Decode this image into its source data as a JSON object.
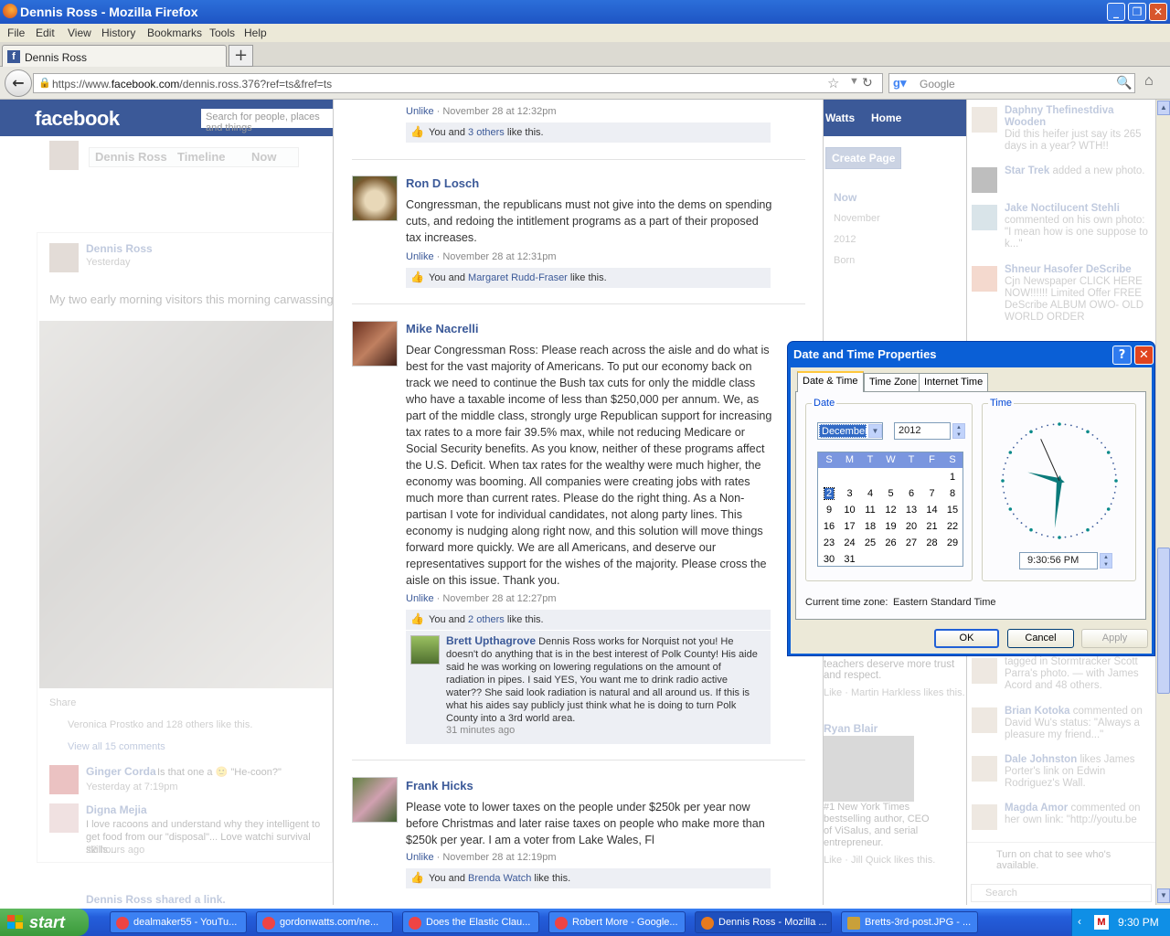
{
  "window": {
    "title": "Dennis Ross - Mozilla Firefox",
    "min": "_",
    "max": "❐",
    "close": "✕"
  },
  "menu": [
    "File",
    "Edit",
    "View",
    "History",
    "Bookmarks",
    "Tools",
    "Help"
  ],
  "tab": {
    "label": "Dennis Ross",
    "new_tab": "+"
  },
  "nav": {
    "url_pre": "https://www.",
    "url_host": "facebook.com",
    "url_post": "/dennis.ross.376?ref=ts&fref=ts",
    "search_placeholder": "Google"
  },
  "fb": {
    "logo": "facebook",
    "search_placeholder": "Search for people, places and things",
    "top_name": "Watts",
    "home": "Home",
    "create_page": "Create Page",
    "profile_name": "Dennis Ross",
    "timeline": "Timeline",
    "now": "Now",
    "timeline_years": [
      "Now",
      "November",
      "2012",
      "Born"
    ],
    "post_author": "Dennis Ross",
    "post_time": "Yesterday",
    "post_text": "My two early morning visitors this morning carwassing",
    "share": "Share",
    "likes_summary": "Veronica Prostko and 128 others like this.",
    "view_all": "View all 15 comments",
    "c1_name": "Ginger Corda",
    "c1_text": "Is that one a 🙂 \"He-coon?\"",
    "c1_time": "Yesterday at 7:19pm",
    "c2_name": "Digna Mejia",
    "c2_text": "I love racoons and understand why they intelligent to get food from our \"disposal\"... Love watchi survival skills...",
    "c2_time": "22 hours ago",
    "shared_link": "Dennis Ross shared a link.",
    "right_col_text": "teachers deserve more trust and respect.",
    "right_col_like": "Like · Martin Harkless likes this.",
    "ryan_name": "Ryan Blair",
    "ryan_text": "#1 New York Times bestselling author, CEO of ViSalus, and serial entrepreneur.",
    "ryan_like": "Like · Jill Quick likes this."
  },
  "comments": [
    {
      "meta_action": "Unlike",
      "meta_time": "November 28 at 12:32pm",
      "like_pre": "You and ",
      "like_link": "3 others",
      "like_post": " like this."
    },
    {
      "name": "Ron D Losch",
      "body": "Congressman, the republicans must not give into the dems on spending cuts, and redoing the intitlement programs as a part of their proposed tax increases.",
      "meta_action": "Unlike",
      "meta_time": "November 28 at 12:31pm",
      "like_pre": "You and ",
      "like_link": "Margaret Rudd-Fraser",
      "like_post": " like this."
    },
    {
      "name": "Mike Nacrelli",
      "body": "Dear Congressman Ross: Please reach across the aisle and do what is best for the vast majority of Americans. To put our economy back on track we need to continue the Bush tax cuts for only the middle class who have a taxable income of less than $250,000 per annum. We, as part of the middle class, strongly urge Republican support for increasing tax rates to a more fair 39.5% max, while not reducing Medicare or Social Security benefits. As you know, neither of these programs affect the U.S. Deficit. When tax rates for the wealthy were much higher, the economy was booming. All companies were creating jobs with rates much more than current rates. Please do the right thing. As a Non-partisan I vote for individual candidates, not along party lines. This economy is nudging along right now, and this solution will move things forward more quickly. We are all Americans, and deserve our representatives support for the wishes of the majority. Please cross the aisle on this issue. Thank you.",
      "meta_action": "Unlike",
      "meta_time": "November 28 at 12:27pm",
      "like_pre": "You and ",
      "like_link": "2 others",
      "like_post": " like this.",
      "reply": {
        "name": "Brett Upthagrove",
        "body": "Dennis Ross works for Norquist not you! He doesn't do anything that is in the best interest of Polk County! His aide said he was working on lowering regulations on the amount of radiation in pipes. I said YES, You want me to drink radio active water?? She said look radiation is natural and all around us. If this is what his aides say publicly just think what he is doing to turn Polk County into a 3rd world area.",
        "time": "31 minutes ago"
      }
    },
    {
      "name": "Frank Hicks",
      "body": "Please vote to lower taxes on the people under $250k per year now before Christmas and later raise taxes on people who make more than $250k per year. I am a voter from Lake Wales, Fl",
      "meta_action": "Unlike",
      "meta_time": "November 28 at 12:19pm",
      "like_pre": "You and ",
      "like_link": "Brenda Watch",
      "like_post": " like this."
    }
  ],
  "sidebar": [
    {
      "name": "Daphny Thefinestdiva Wooden",
      "text": "Did this heifer just say its 265 days in a year? WTH!!"
    },
    {
      "name": "Star Trek",
      "text": "added a new photo."
    },
    {
      "name": "Jake Noctilucent Stehli",
      "text": "commented on his own photo: \"I mean how is one suppose to k...\""
    },
    {
      "name": "Shneur Hasofer DeScribe",
      "text": "Cjn Newspaper CLICK HERE NOW!!!!!! Limited Offer FREE DeScribe ALBUM OWO- OLD WORLD ORDER"
    },
    {
      "name": "",
      "text": "tagged in Stormtracker Scott Parra's photo. — with James Acord and 48 others."
    },
    {
      "name": "Brian Kotoka",
      "text": "commented on David Wu's status: \"Always a pleasure my friend...\""
    },
    {
      "name": "Dale Johnston",
      "text": "likes James Porter's link on Edwin Rodriguez's Wall."
    },
    {
      "name": "Magda Amor",
      "text": "commented on her own link: \"http://youtu.be"
    }
  ],
  "chat_notice": "Turn on chat to see who's available.",
  "chat_search": "Search",
  "dialog": {
    "title": "Date and Time Properties",
    "help": "?",
    "close": "✕",
    "tabs": [
      "Date & Time",
      "Time Zone",
      "Internet Time"
    ],
    "date_label": "Date",
    "time_label": "Time",
    "month": "December",
    "year": "2012",
    "weekdays": [
      "S",
      "M",
      "T",
      "W",
      "T",
      "F",
      "S"
    ],
    "days": [
      [
        "",
        "",
        "",
        "",
        "",
        "",
        "1"
      ],
      [
        "2",
        "3",
        "4",
        "5",
        "6",
        "7",
        "8"
      ],
      [
        "9",
        "10",
        "11",
        "12",
        "13",
        "14",
        "15"
      ],
      [
        "16",
        "17",
        "18",
        "19",
        "20",
        "21",
        "22"
      ],
      [
        "23",
        "24",
        "25",
        "26",
        "27",
        "28",
        "29"
      ],
      [
        "30",
        "31",
        "",
        "",
        "",
        "",
        ""
      ]
    ],
    "selected_day": "2",
    "time_value": "9:30:56 PM",
    "clock": {
      "hour": 9,
      "minute": 30,
      "second": 56
    },
    "tz_label": "Current time zone:",
    "tz_value": "Eastern Standard Time",
    "ok": "OK",
    "cancel": "Cancel",
    "apply": "Apply"
  },
  "taskbar": {
    "start": "start",
    "items": [
      "dealmaker55 - YouTu...",
      "gordonwatts.com/ne...",
      "Does the Elastic Clau...",
      "Robert More - Google...",
      "Dennis Ross - Mozilla ...",
      "Bretts-3rd-post.JPG - ..."
    ],
    "clock": "9:30 PM"
  }
}
